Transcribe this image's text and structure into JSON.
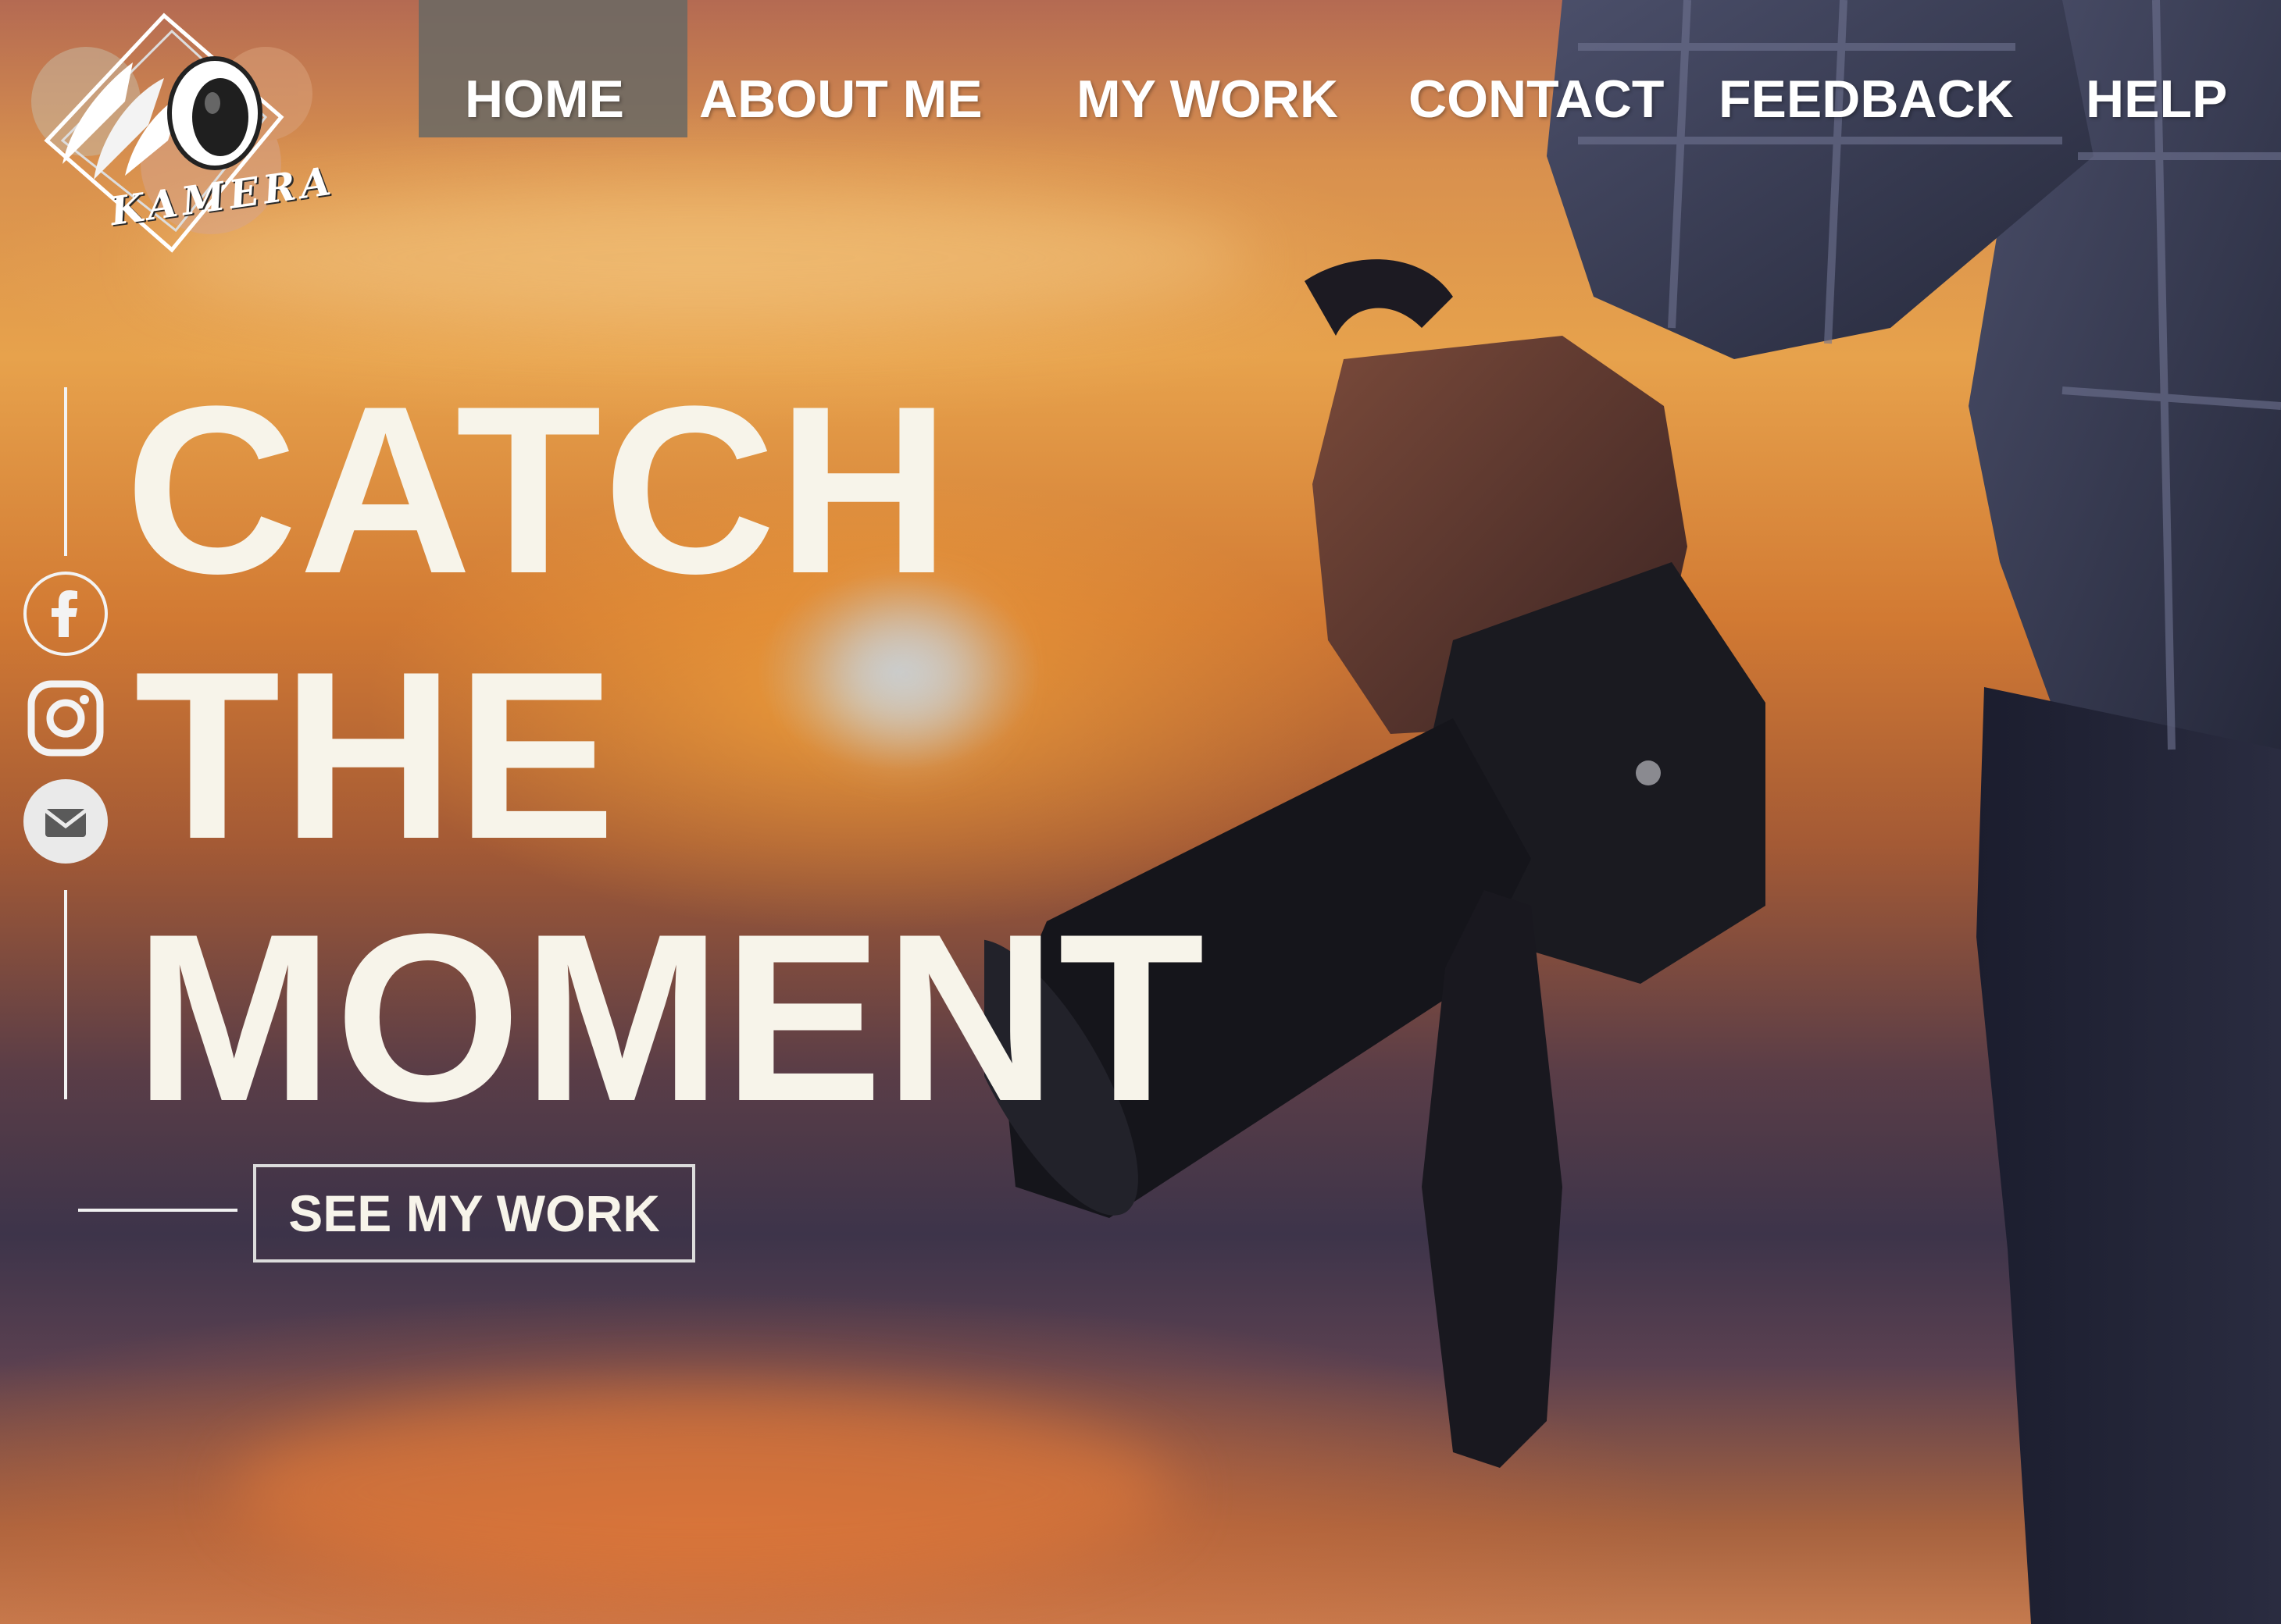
{
  "logo": {
    "text": "KAMERA"
  },
  "nav": {
    "items": [
      {
        "label": "HOME",
        "active": true
      },
      {
        "label": "ABOUT ME"
      },
      {
        "label": "MY WORK"
      },
      {
        "label": "CONTACT"
      },
      {
        "label": "FEEDBACK"
      },
      {
        "label": "HELP"
      }
    ]
  },
  "social": {
    "icons": [
      "facebook-icon",
      "instagram-icon",
      "mail-icon"
    ]
  },
  "hero": {
    "line1": "CATCH",
    "line2": "THE",
    "line3": "MOMENT",
    "cta_label": "SEE MY WORK"
  },
  "colors": {
    "nav_active_bg": "#696964",
    "text": "#ffffff"
  }
}
